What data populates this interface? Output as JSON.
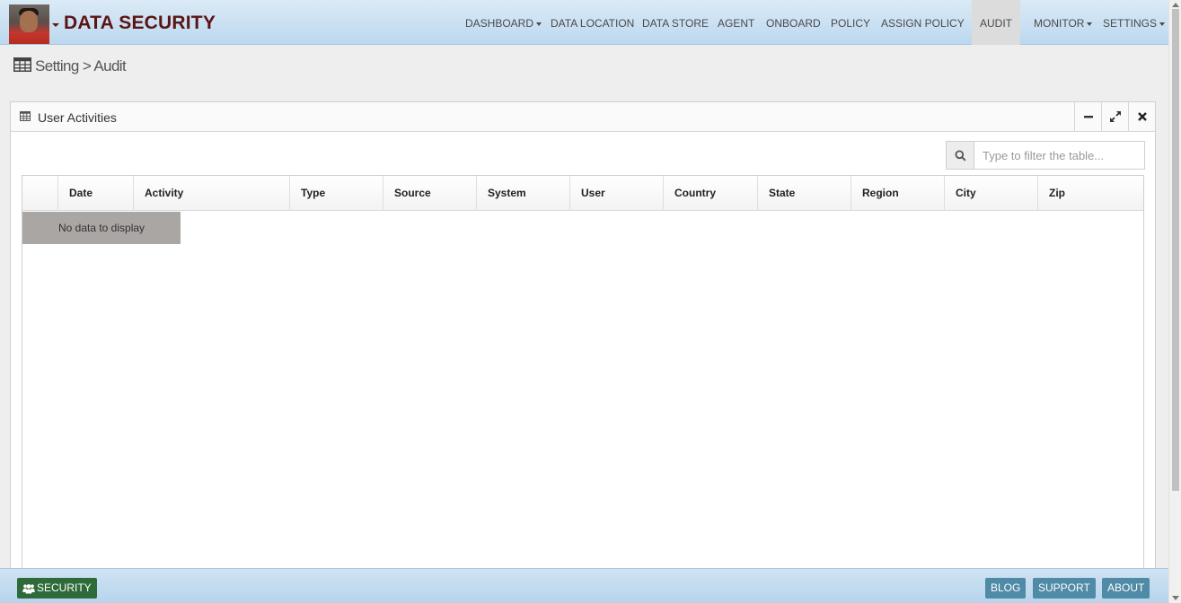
{
  "app": {
    "title": "DATA SECURITY"
  },
  "nav": {
    "items": [
      {
        "label": "DASHBOARD",
        "dropdown": true
      },
      {
        "label": "DATA LOCATION",
        "dropdown": false
      },
      {
        "label": "DATA STORE",
        "dropdown": false
      },
      {
        "label": "AGENT",
        "dropdown": false
      },
      {
        "label": "ONBOARD",
        "dropdown": false
      },
      {
        "label": "POLICY",
        "dropdown": false
      },
      {
        "label": "ASSIGN POLICY",
        "dropdown": false
      },
      {
        "label": "AUDIT",
        "dropdown": false,
        "active": true
      },
      {
        "label": "MONITOR",
        "dropdown": true
      },
      {
        "label": "SETTINGS",
        "dropdown": true
      }
    ]
  },
  "breadcrumb": {
    "text": "Setting > Audit",
    "icon": "table-icon"
  },
  "widget": {
    "title": "User Activities",
    "icon": "table-icon",
    "controls": [
      "minimize-icon",
      "expand-icon",
      "close-icon"
    ]
  },
  "search": {
    "placeholder": "Type to filter the table...",
    "value": "",
    "icon": "search-icon"
  },
  "table": {
    "columns": [
      "",
      "Date",
      "Activity",
      "Type",
      "Source",
      "System",
      "User",
      "Country",
      "State",
      "Region",
      "City",
      "Zip"
    ],
    "rows": [],
    "empty_message": "No data to display"
  },
  "footer": {
    "security_label": "SECURITY",
    "security_icon": "users-icon",
    "blog_label": "BLOG",
    "support_label": "SUPPORT",
    "about_label": "ABOUT"
  },
  "colors": {
    "brand": "#5b1414",
    "topbar": "#c9e0f2",
    "security_button": "#2f6b3a",
    "footer_button": "#4f8aa6"
  }
}
